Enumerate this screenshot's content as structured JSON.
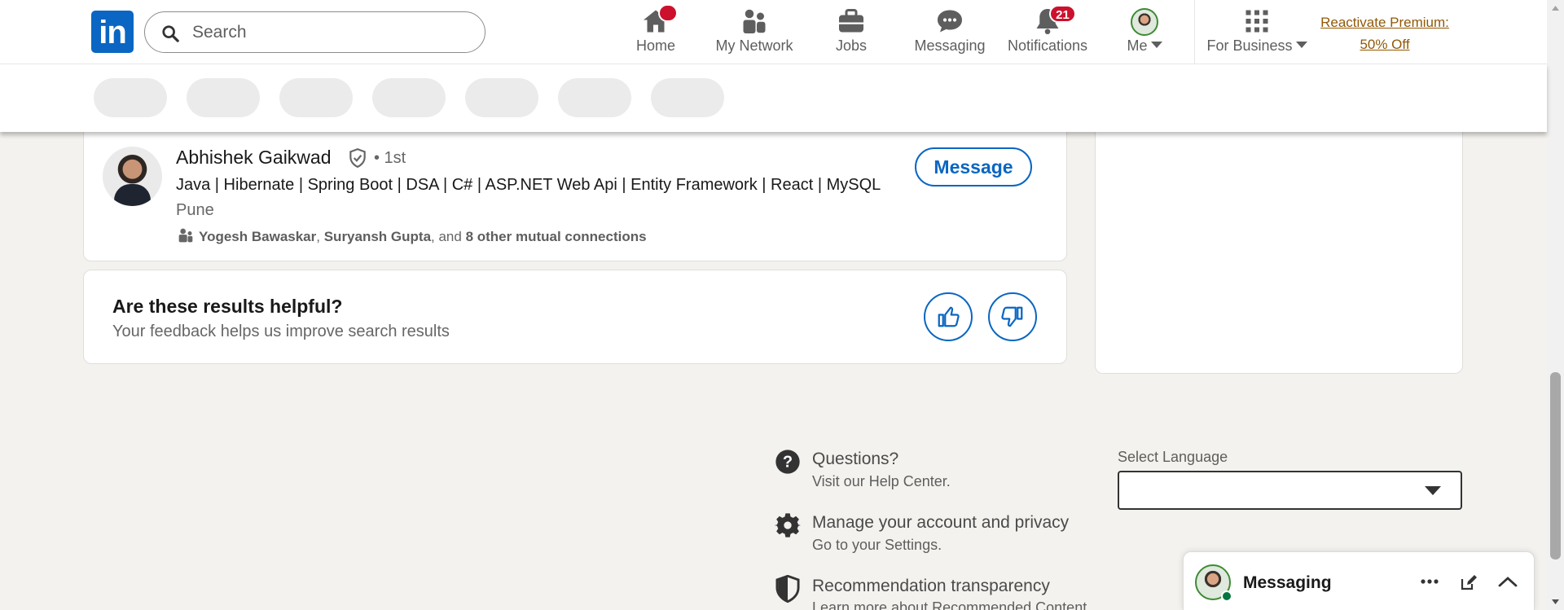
{
  "header": {
    "logo_text": "in",
    "search": {
      "placeholder": "Search",
      "value": ""
    },
    "nav": [
      {
        "label": "Home",
        "icon": "home-icon",
        "badge": ""
      },
      {
        "label": "My Network",
        "icon": "network-icon"
      },
      {
        "label": "Jobs",
        "icon": "briefcase-icon"
      },
      {
        "label": "Messaging",
        "icon": "messaging-icon"
      },
      {
        "label": "Notifications",
        "icon": "bell-icon",
        "badge": "21"
      },
      {
        "label": "Me",
        "icon": "avatar"
      },
      {
        "label": "For Business",
        "icon": "grid-icon"
      }
    ],
    "premium": {
      "line1": "Reactivate Premium:",
      "line2": "50% Off"
    }
  },
  "filter_pills": [
    "",
    "",
    "",
    "",
    "",
    "",
    ""
  ],
  "result": {
    "name": "Abhishek Gaikwad",
    "degree": "• 1st",
    "headline": "Java | Hibernate | Spring Boot | DSA | C# | ASP.NET Web Api | Entity Framework | React | MySQL",
    "location": "Pune",
    "mutual": {
      "name1": "Yogesh Bawaskar",
      "sep1": ", ",
      "name2": "Suryansh Gupta",
      "sep2": ", and ",
      "others": "8 other mutual connections"
    },
    "action": "Message"
  },
  "feedback": {
    "title": "Are these results helpful?",
    "subtitle": "Your feedback helps us improve search results"
  },
  "footer": {
    "items": [
      {
        "title": "Questions?",
        "sub": "Visit our Help Center.",
        "icon": "question-icon"
      },
      {
        "title": "Manage your account and privacy",
        "sub": "Go to your Settings.",
        "icon": "gear-icon"
      },
      {
        "title": "Recommendation transparency",
        "sub": "Learn more about Recommended Content.",
        "icon": "shield-icon"
      }
    ],
    "language": {
      "label": "Select Language",
      "value": ""
    }
  },
  "messaging_dock": {
    "title": "Messaging"
  },
  "colors": {
    "brand": "#0a66c2",
    "badge": "#cb112d",
    "premium": "#915907",
    "background": "#f4f2ee"
  }
}
